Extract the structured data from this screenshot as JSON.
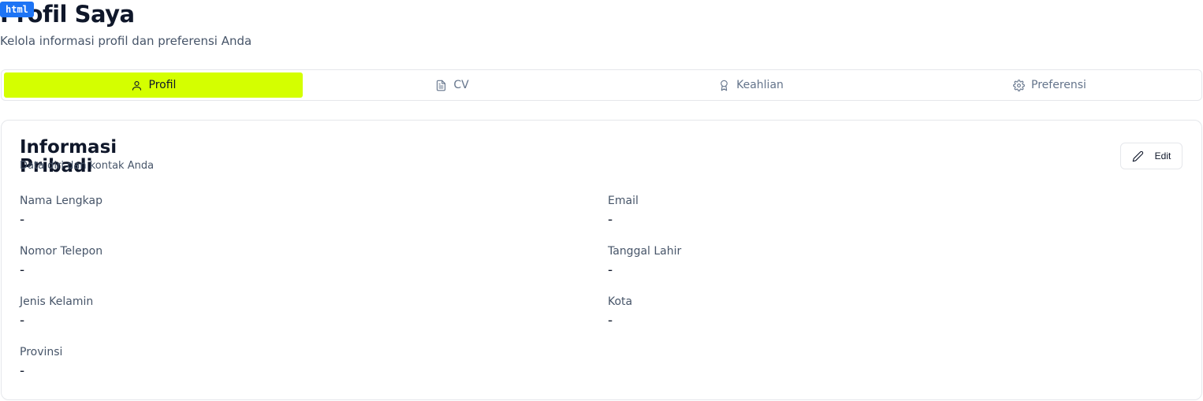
{
  "badge": "html",
  "page": {
    "title": "Profil Saya",
    "subtitle": "Kelola informasi profil dan preferensi Anda"
  },
  "tabs": [
    {
      "label": "Profil",
      "icon": "user-icon",
      "active": true
    },
    {
      "label": "CV",
      "icon": "file-text-icon",
      "active": false
    },
    {
      "label": "Keahlian",
      "icon": "award-icon",
      "active": false
    },
    {
      "label": "Preferensi",
      "icon": "settings-icon",
      "active": false
    }
  ],
  "card": {
    "title": "Informasi Pribadi",
    "description": "Data diri dan kontak Anda",
    "edit_label": "Edit",
    "fields": [
      {
        "label": "Nama Lengkap",
        "value": "-"
      },
      {
        "label": "Email",
        "value": "-"
      },
      {
        "label": "Nomor Telepon",
        "value": "-"
      },
      {
        "label": "Tanggal Lahir",
        "value": "-"
      },
      {
        "label": "Jenis Kelamin",
        "value": "-"
      },
      {
        "label": "Kota",
        "value": "-"
      },
      {
        "label": "Provinsi",
        "value": "-"
      }
    ]
  },
  "colors": {
    "accent": "#d4ff00",
    "badge": "#1d74f5",
    "text": "#0f172a",
    "muted": "#475569",
    "border": "#e5e7eb"
  }
}
